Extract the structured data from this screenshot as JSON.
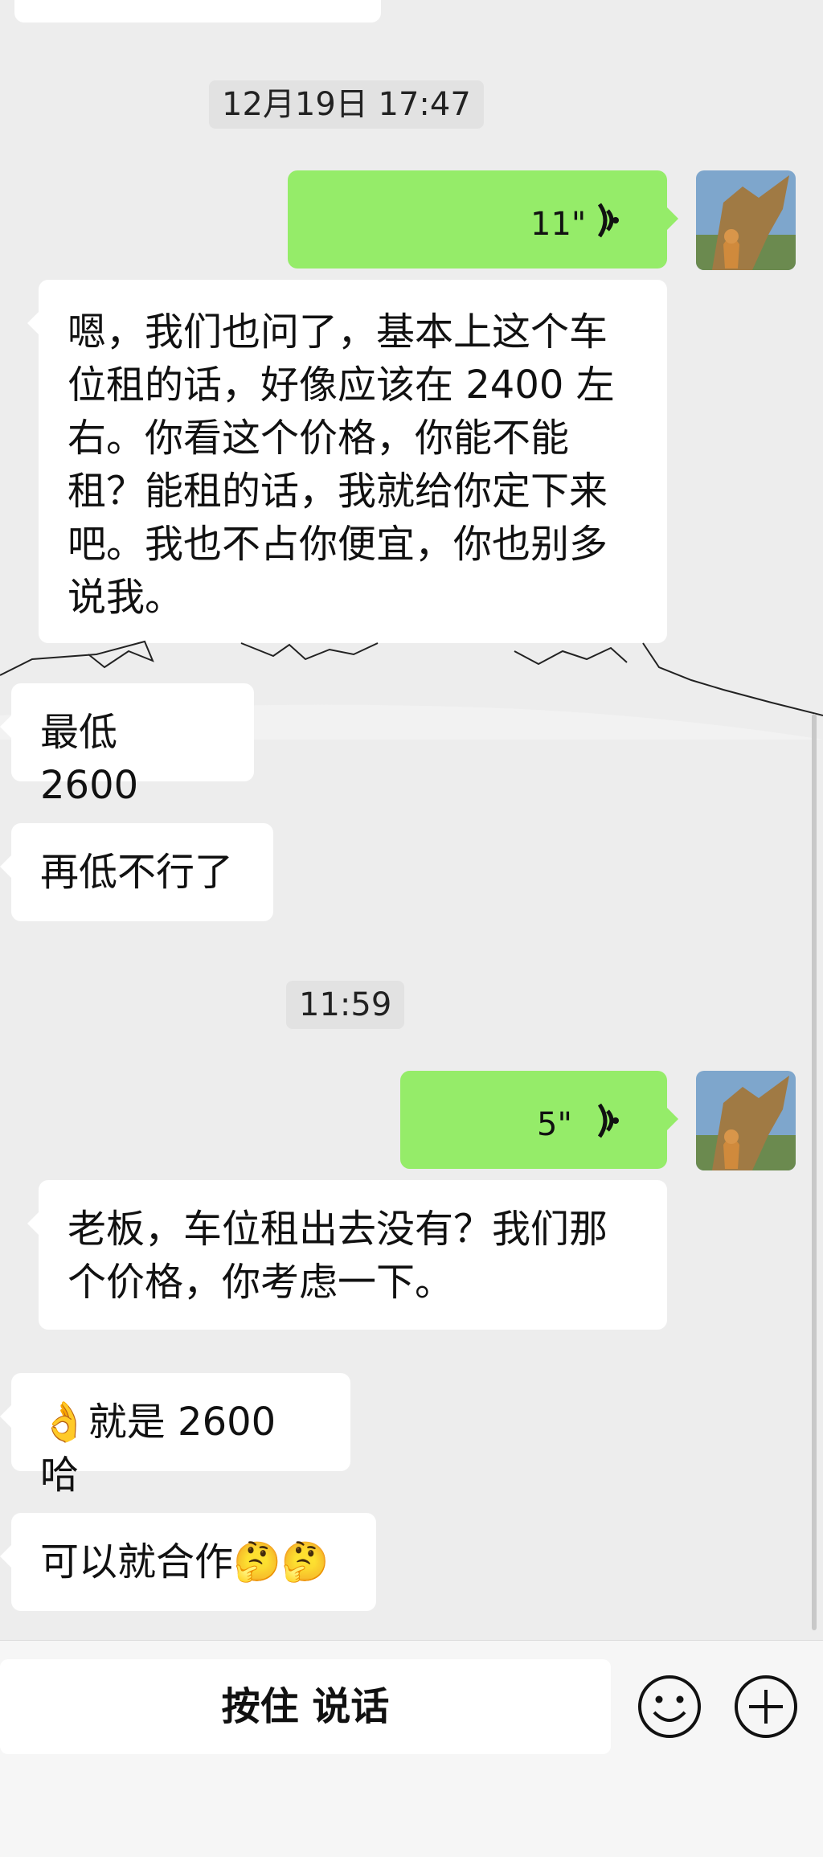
{
  "timestamps": [
    "12月19日 17:47",
    "11:59"
  ],
  "voice_messages": [
    {
      "duration": "11\""
    },
    {
      "duration": "5\""
    }
  ],
  "messages": [
    {
      "text": "嗯，我们也问了，基本上这个车位租的话，好像应该在2400左右。你看这个价格，你能不能租？能租的话，我就给你定下来吧。我也不占你便宜，你也别多说我。",
      "lines": [
        "嗯，我们也问了，基本上这个车",
        "位租的话，好像应该在 2400 左",
        "右。你看这个价格，你能不能",
        "租？能租的话，我就给你定下来",
        "吧。我也不占你便宜，你也别多",
        "说我。"
      ]
    },
    {
      "text": "最低 2600"
    },
    {
      "text": "再低不行了"
    },
    {
      "text": "老板，车位租出去没有？我们那个价格，你考虑一下。",
      "lines": [
        "老板，车位租出去没有？我们那",
        "个价格，你考虑一下。"
      ]
    },
    {
      "emoji": "👌",
      "text": "就是 2600 哈"
    },
    {
      "text": "可以就合作",
      "emoji": "🤔🤔"
    }
  ],
  "input_bar": {
    "talk_label": "按住 说话",
    "emoji_icon": "smile-icon",
    "add_icon": "plus-icon"
  },
  "colors": {
    "sent_bubble": "#95ec69",
    "received_bubble": "#ffffff",
    "background": "#ededed"
  }
}
